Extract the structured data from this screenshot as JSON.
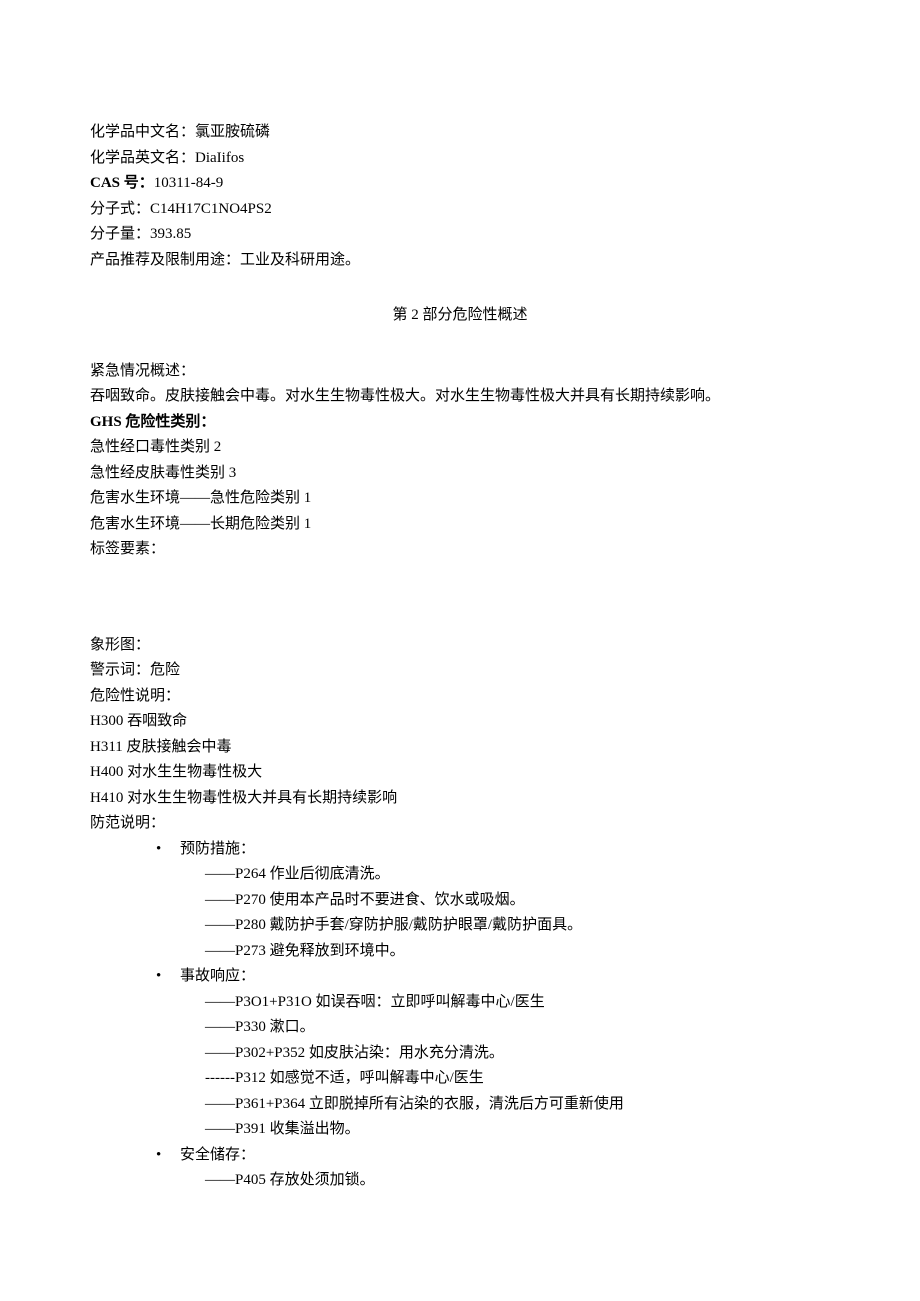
{
  "id": {
    "cn_name_label": "化学品中文名：",
    "cn_name": "氯亚胺硫磷",
    "en_name_label": "化学品英文名：",
    "en_name": "DiaIifos",
    "cas_label": "CAS 号：",
    "cas": "10311-84-9",
    "formula_label": "分子式：",
    "formula": "C14H17C1NO4PS2",
    "mw_label": "分子量：",
    "mw": "393.85",
    "use_label": "产品推荐及限制用途：",
    "use": "工业及科研用途。"
  },
  "section2_title": "第 2 部分危险性概述",
  "hazard": {
    "emergency_label": "紧急情况概述：",
    "emergency_text": "吞咽致命。皮肤接触会中毒。对水生生物毒性极大。对水生生物毒性极大并具有长期持续影响。",
    "ghs_label": "GHS 危险性类别：",
    "ghs": [
      "急性经口毒性类别 2",
      "急性经皮肤毒性类别 3",
      "危害水生环境——急性危险类别 1",
      "危害水生环境——长期危险类别 1"
    ],
    "label_elements": "标签要素：",
    "pictogram": "象形图：",
    "signal_label": "警示词：",
    "signal": "危险",
    "hazard_statements_label": "危险性说明：",
    "hazard_statements": [
      "H300 吞咽致命",
      "H311 皮肤接触会中毒",
      "H400 对水生生物毒性极大",
      "H410 对水生生物毒性极大并具有长期持续影响"
    ],
    "precaution_label": "防范说明：",
    "precaution_groups": [
      {
        "title": "预防措施：",
        "prefix": "——",
        "lines": [
          "——P264 作业后彻底清洗。",
          "——P270 使用本产品时不要进食、饮水或吸烟。",
          "——P280 戴防护手套/穿防护服/戴防护眼罩/戴防护面具。",
          "——P273 避免释放到环境中。"
        ]
      },
      {
        "title": "事故响应：",
        "prefix": "——",
        "lines": [
          "——P3O1+P31O 如误吞咽：立即呼叫解毒中心/医生",
          "——P330 漱口。",
          "——P302+P352 如皮肤沾染：用水充分清洗。",
          "------P312 如感觉不适，呼叫解毒中心/医生",
          "——P361+P364 立即脱掉所有沾染的衣服，清洗后方可重新使用",
          "——P391 收集溢出物。"
        ]
      },
      {
        "title": "安全储存：",
        "prefix": "——",
        "lines": [
          "——P405 存放处须加锁。"
        ]
      }
    ]
  }
}
